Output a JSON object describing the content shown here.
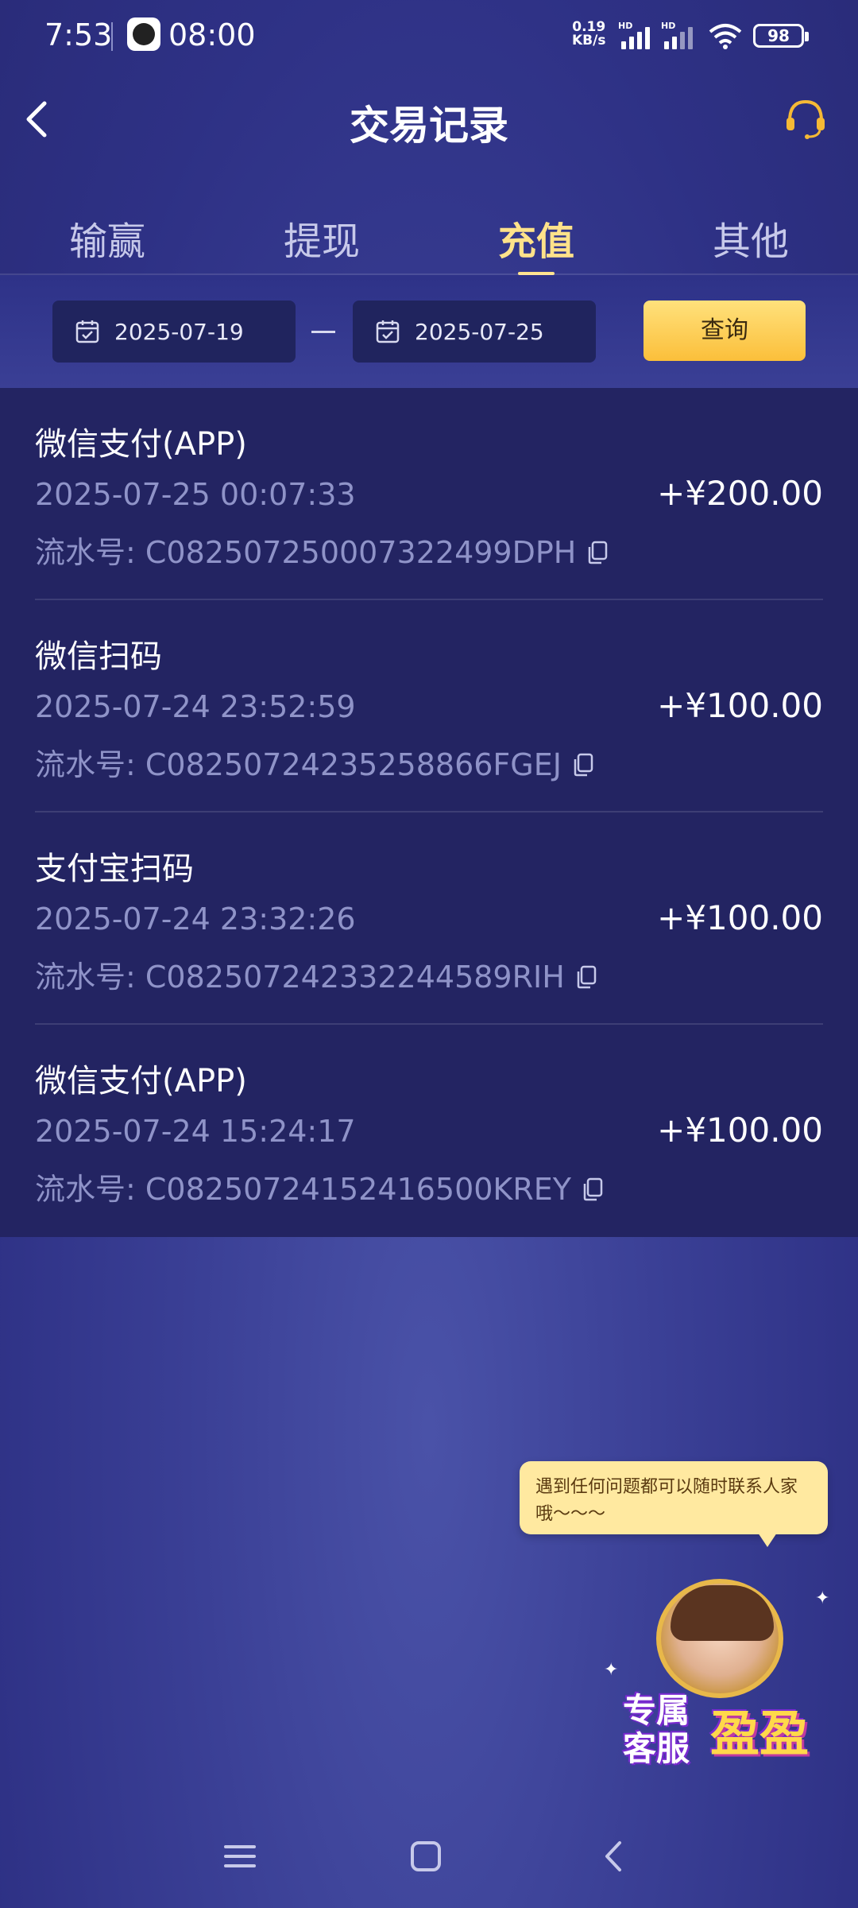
{
  "status_bar": {
    "time": "7:53",
    "alarm": "08:00",
    "net_speed_value": "0.19",
    "net_speed_unit": "KB/s",
    "hd_label": "HD",
    "battery": "98"
  },
  "header": {
    "title": "交易记录",
    "back_icon": "chevron-left-icon",
    "support_icon": "headset-icon"
  },
  "tabs": [
    {
      "label": "输赢",
      "active": false
    },
    {
      "label": "提现",
      "active": false
    },
    {
      "label": "充值",
      "active": true
    },
    {
      "label": "其他",
      "active": false
    }
  ],
  "filter": {
    "start_date": "2025-07-19",
    "end_date": "2025-07-25",
    "query_label": "查询"
  },
  "records": [
    {
      "method": "微信支付(APP)",
      "time": "2025-07-25 00:07:33",
      "amount": "+¥200.00",
      "serial": "流水号: C082507250007322499DPH"
    },
    {
      "method": "微信扫码",
      "time": "2025-07-24 23:52:59",
      "amount": "+¥100.00",
      "serial": "流水号: C08250724235258866FGEJ"
    },
    {
      "method": "支付宝扫码",
      "time": "2025-07-24 23:32:26",
      "amount": "+¥100.00",
      "serial": "流水号: C08250724233224458 9RIH"
    },
    {
      "method": "微信支付(APP)",
      "time": "2025-07-24 15:24:17",
      "amount": "+¥100.00",
      "serial": "流水号: C08250724152416500KREY"
    }
  ],
  "chat_bubble": {
    "text": "遇到任何问题都可以随时联系人家哦～～～"
  },
  "customer_service": {
    "line1": "专属",
    "line2": "客服",
    "name": "盈盈"
  },
  "colors": {
    "accent": "#ffe28a",
    "query_button": "#fbbf3a",
    "list_bg": "#232462",
    "muted_text": "#8f93c8"
  }
}
